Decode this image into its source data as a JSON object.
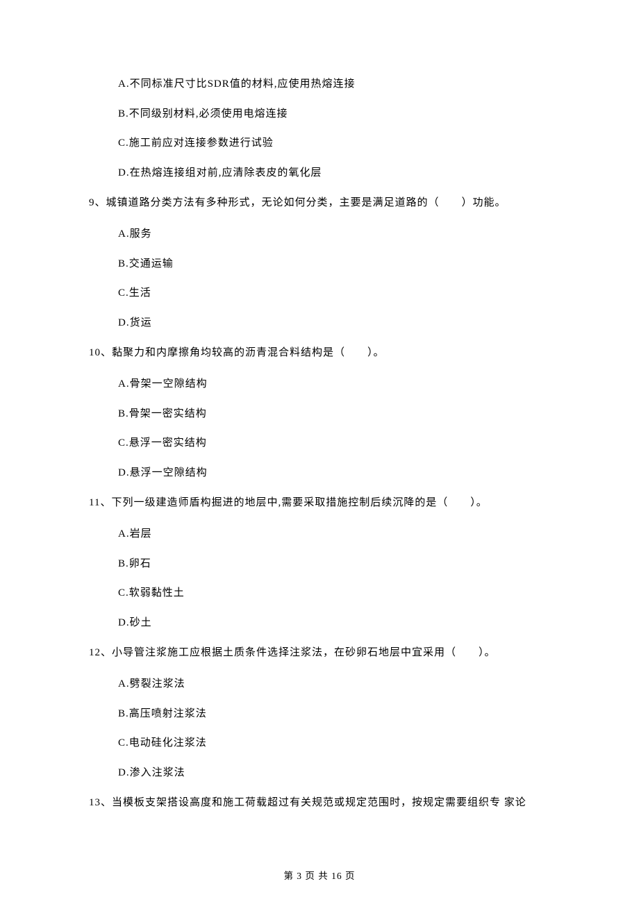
{
  "prev_question_options": {
    "a": "A.不同标准尺寸比SDR值的材料,应使用热熔连接",
    "b": "B.不同级别材料,必须使用电熔连接",
    "c": "C.施工前应对连接参数进行试验",
    "d": "D.在热熔连接组对前,应清除表皮的氧化层"
  },
  "q9": {
    "text": "9、城镇道路分类方法有多种形式，无论如何分类，主要是满足道路的（　　）功能。",
    "options": {
      "a": "A.服务",
      "b": "B.交通运输",
      "c": "C.生活",
      "d": "D.货运"
    }
  },
  "q10": {
    "text": "10、黏聚力和内摩擦角均较高的沥青混合料结构是（　　）。",
    "options": {
      "a": "A.骨架一空隙结构",
      "b": "B.骨架一密实结构",
      "c": "C.悬浮一密实结构",
      "d": "D.悬浮一空隙结构"
    }
  },
  "q11": {
    "text": "11、下列一级建造师盾构掘进的地层中,需要采取措施控制后续沉降的是（　　）。",
    "options": {
      "a": "A.岩层",
      "b": "B.卵石",
      "c": "C.软弱黏性土",
      "d": "D.砂土"
    }
  },
  "q12": {
    "text": "12、小导管注浆施工应根据土质条件选择注浆法，在砂卵石地层中宜采用（　　）。",
    "options": {
      "a": "A.劈裂注浆法",
      "b": "B.高压喷射注浆法",
      "c": "C.电动硅化注浆法",
      "d": "D.渗入注浆法"
    }
  },
  "q13": {
    "text": "13、当模板支架搭设高度和施工荷载超过有关规范或规定范围时，按规定需要组织专 家论"
  },
  "footer": "第 3 页 共 16 页"
}
